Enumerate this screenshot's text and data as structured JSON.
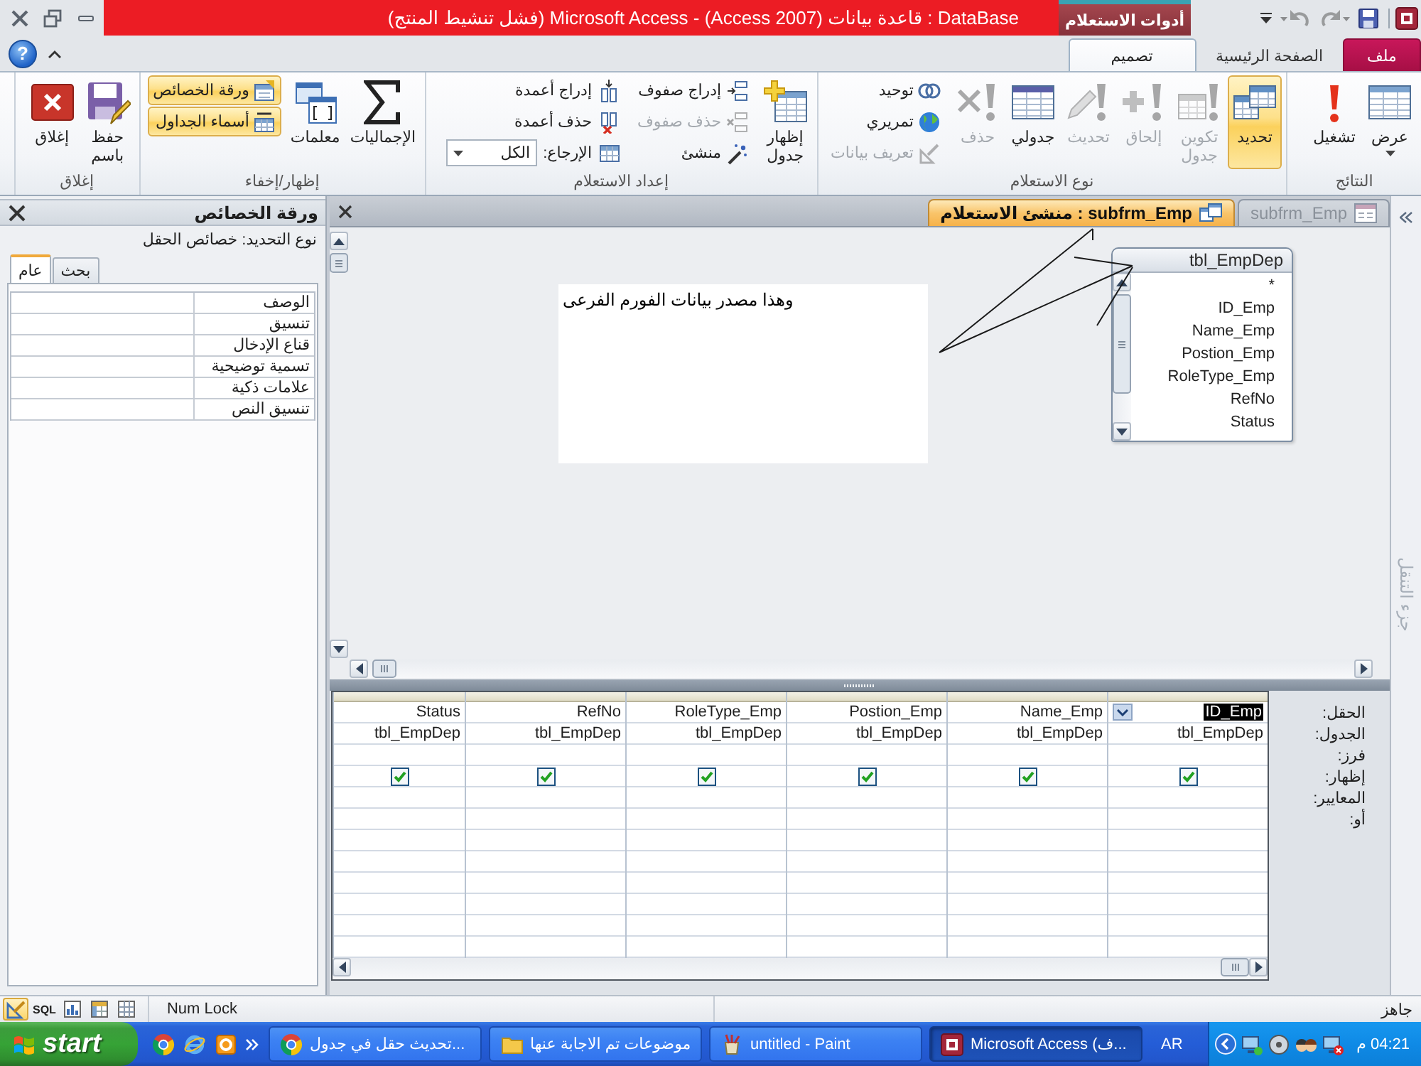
{
  "window": {
    "title": "(فشل تنشيط المنتج) Microsoft Access - (Access 2007) قاعدة بيانات : DataBase",
    "contextual_tab": "أدوات الاستعلام"
  },
  "quick_access": [
    {
      "kind": "save",
      "disabled": false
    },
    {
      "kind": "redo",
      "disabled": true
    },
    {
      "kind": "undo",
      "disabled": true
    },
    {
      "kind": "customize",
      "disabled": false
    }
  ],
  "help": "?",
  "ribbon_tabs": [
    {
      "label": "ملف",
      "kind": "file",
      "selected": false
    },
    {
      "label": "الصفحة الرئيسية",
      "kind": "tab",
      "selected": false
    },
    {
      "label": "تصميم",
      "kind": "tab",
      "selected": true
    }
  ],
  "ribbon_groups": [
    {
      "label": "النتائج",
      "buttons": [
        {
          "label": "عرض",
          "kind": "large",
          "selected": false,
          "disabled": false,
          "dropdown": true
        },
        {
          "label": "تشغيل",
          "kind": "large",
          "selected": false,
          "disabled": false
        }
      ]
    },
    {
      "label": "نوع الاستعلام",
      "buttons": [
        {
          "label": "تحديد",
          "kind": "large",
          "selected": true,
          "disabled": false
        },
        {
          "label": "تكوين جدول",
          "kind": "large",
          "selected": false,
          "disabled": true
        },
        {
          "label": "إلحاق",
          "kind": "large",
          "selected": false,
          "disabled": true
        },
        {
          "label": "تحديث",
          "kind": "large",
          "selected": false,
          "disabled": true
        },
        {
          "label": "جدولي",
          "kind": "large",
          "selected": false,
          "disabled": false
        },
        {
          "label": "حذف",
          "kind": "large",
          "selected": false,
          "disabled": true
        },
        {
          "label": "توحيد",
          "kind": "small",
          "selected": false,
          "disabled": false
        },
        {
          "label": "تمريري",
          "kind": "small",
          "selected": false,
          "disabled": false
        },
        {
          "label": "تعريف بيانات",
          "kind": "small",
          "selected": false,
          "disabled": true
        }
      ]
    },
    {
      "label": "إعداد الاستعلام",
      "buttons": [
        {
          "label": "إظهار جدول",
          "kind": "large",
          "selected": false,
          "disabled": false
        },
        {
          "label": "إدراج صفوف",
          "kind": "small",
          "selected": false,
          "disabled": false
        },
        {
          "label": "حذف صفوف",
          "kind": "small",
          "selected": false,
          "disabled": true
        },
        {
          "label": "منشئ",
          "kind": "small",
          "selected": false,
          "disabled": false
        },
        {
          "label": "إدراج أعمدة",
          "kind": "small",
          "selected": false,
          "disabled": false
        },
        {
          "label": "حذف أعمدة",
          "kind": "small",
          "selected": false,
          "disabled": false
        },
        {
          "label": "الإرجاع:",
          "kind": "combo",
          "value": "الكل",
          "selected": false,
          "disabled": false
        }
      ]
    },
    {
      "label": "إظهار/إخفاء",
      "buttons": [
        {
          "label": "الإجماليات",
          "kind": "large",
          "selected": false,
          "disabled": false
        },
        {
          "label": "معلمات",
          "kind": "large",
          "selected": false,
          "disabled": false
        },
        {
          "label": "ورقة الخصائص",
          "kind": "small",
          "selected": true,
          "disabled": false
        },
        {
          "label": "أسماء الجداول",
          "kind": "small",
          "selected": true,
          "disabled": false
        }
      ]
    },
    {
      "label": "إغلاق",
      "buttons": [
        {
          "label": "حفظ باسم",
          "kind": "large",
          "selected": false,
          "disabled": false
        },
        {
          "label": "إغلاق",
          "kind": "large",
          "selected": false,
          "disabled": false
        }
      ]
    }
  ],
  "property_sheet": {
    "title": "ورقة الخصائص",
    "selection_type": "نوع التحديد: خصائص الحقل",
    "tabs": [
      {
        "label": "بحث",
        "selected": false
      },
      {
        "label": "عام",
        "selected": true
      }
    ],
    "properties": [
      "الوصف",
      "تنسيق",
      "قناع الإدخال",
      "تسمية توضيحية",
      "علامات ذكية",
      "تنسيق النص"
    ]
  },
  "document": {
    "tabs": [
      {
        "label": "subfrm_Emp",
        "kind": "form",
        "selected": false
      },
      {
        "label": "subfrm_Emp : منشئ الاستعلام",
        "kind": "query",
        "selected": true
      }
    ],
    "note": "وهذا مصدر بيانات الفورم الفرعى",
    "field_list": {
      "title": "tbl_EmpDep",
      "fields": [
        "*",
        "ID_Emp",
        "Name_Emp",
        "Postion_Emp",
        "RoleType_Emp",
        "RefNo",
        "Status"
      ]
    },
    "grid": {
      "row_labels": [
        "الحقل:",
        "الجدول:",
        "فرز:",
        "إظهار:",
        "المعايير:",
        "أو:"
      ],
      "columns": [
        {
          "field": "ID_Emp",
          "table": "tbl_EmpDep",
          "show": true,
          "selected": true
        },
        {
          "field": "Name_Emp",
          "table": "tbl_EmpDep",
          "show": true,
          "selected": false
        },
        {
          "field": "Postion_Emp",
          "table": "tbl_EmpDep",
          "show": true,
          "selected": false
        },
        {
          "field": "RoleType_Emp",
          "table": "tbl_EmpDep",
          "show": true,
          "selected": false
        },
        {
          "field": "RefNo",
          "table": "tbl_EmpDep",
          "show": true,
          "selected": false
        },
        {
          "field": "Status",
          "table": "tbl_EmpDep",
          "show": true,
          "selected": false
        }
      ]
    }
  },
  "navigation_pane": {
    "label": "جزء التنقل"
  },
  "status_bar": {
    "views": [
      {
        "kind": "design",
        "selected": true
      },
      {
        "kind": "sql",
        "label": "SQL",
        "selected": false
      },
      {
        "kind": "pivot_chart",
        "selected": false
      },
      {
        "kind": "pivot_table",
        "selected": false
      },
      {
        "kind": "datasheet",
        "selected": false
      }
    ],
    "indicator": "Num Lock",
    "status": "جاهز"
  },
  "taskbar": {
    "start": "start",
    "quick_launch": [
      {
        "kind": "chrome"
      },
      {
        "kind": "ie"
      },
      {
        "kind": "outlook"
      }
    ],
    "tasks": [
      {
        "label": "Microsoft Access (ف...",
        "kind": "access",
        "selected": true
      },
      {
        "label": "untitled - Paint",
        "kind": "paint",
        "selected": false
      },
      {
        "label": "موضوعات تم الاجابة عنها",
        "kind": "folder",
        "selected": false
      },
      {
        "label": "تحديث حقل في جدول...",
        "kind": "chrome",
        "selected": false
      }
    ],
    "language": "AR",
    "clock": "04:21 م"
  }
}
